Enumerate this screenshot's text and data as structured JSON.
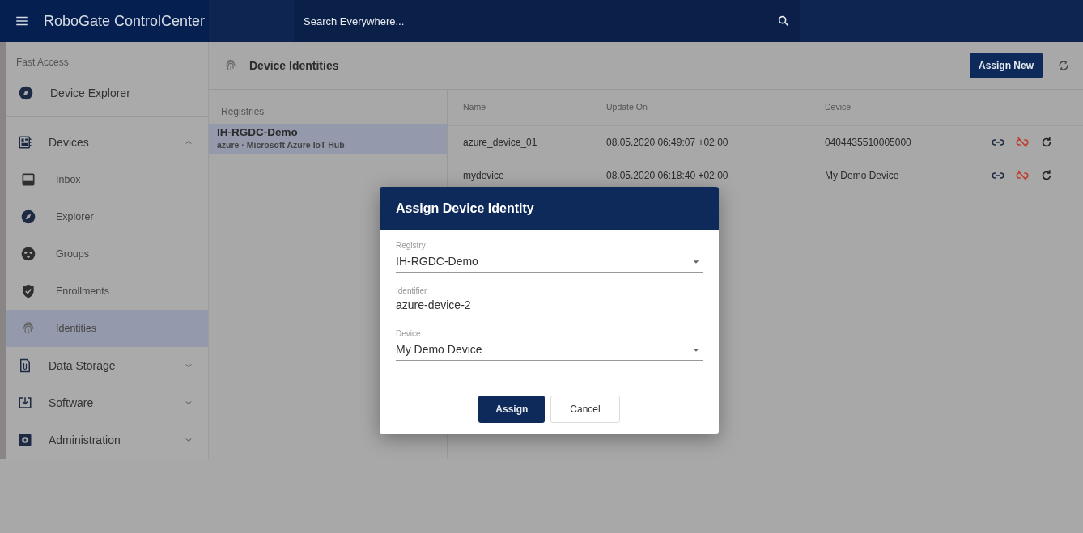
{
  "app": {
    "title": "RoboGate ControlCenter",
    "search_placeholder": "Search Everywhere..."
  },
  "sidebar": {
    "heading": "Fast Access",
    "quick": [
      {
        "label": "Device Explorer",
        "selected": false
      }
    ],
    "sections": [
      {
        "label": "Devices",
        "expanded": true,
        "children": [
          {
            "label": "Inbox",
            "selected": false
          },
          {
            "label": "Explorer",
            "selected": false
          },
          {
            "label": "Groups",
            "selected": false
          },
          {
            "label": "Enrollments",
            "selected": false
          },
          {
            "label": "Identities",
            "selected": true
          }
        ]
      },
      {
        "label": "Data Storage",
        "expanded": false
      },
      {
        "label": "Software",
        "expanded": false
      },
      {
        "label": "Administration",
        "expanded": false
      }
    ]
  },
  "page": {
    "title": "Device Identities",
    "assign_button": "Assign New"
  },
  "registries": {
    "heading": "Registries",
    "items": [
      {
        "name": "IH-RGDC-Demo",
        "subtitle": "azure · Microsoft Azure IoT Hub",
        "selected": true
      }
    ]
  },
  "table": {
    "columns": [
      "Name",
      "Update On",
      "Device"
    ],
    "rows": [
      {
        "name": "azure_device_01",
        "updated": "08.05.2020 06:49:07 +02:00",
        "device": "0404435510005000"
      },
      {
        "name": "mydevice",
        "updated": "08.05.2020 06:18:40 +02:00",
        "device": "My Demo Device"
      }
    ]
  },
  "dialog": {
    "title": "Assign Device Identity",
    "fields": [
      {
        "label": "Registry",
        "value": "IH-RGDC-Demo",
        "kind": "select"
      },
      {
        "label": "Identifier",
        "value": "azure-device-2",
        "kind": "text"
      },
      {
        "label": "Device",
        "value": "My Demo Device",
        "kind": "select"
      }
    ],
    "primary": "Assign",
    "secondary": "Cancel"
  }
}
